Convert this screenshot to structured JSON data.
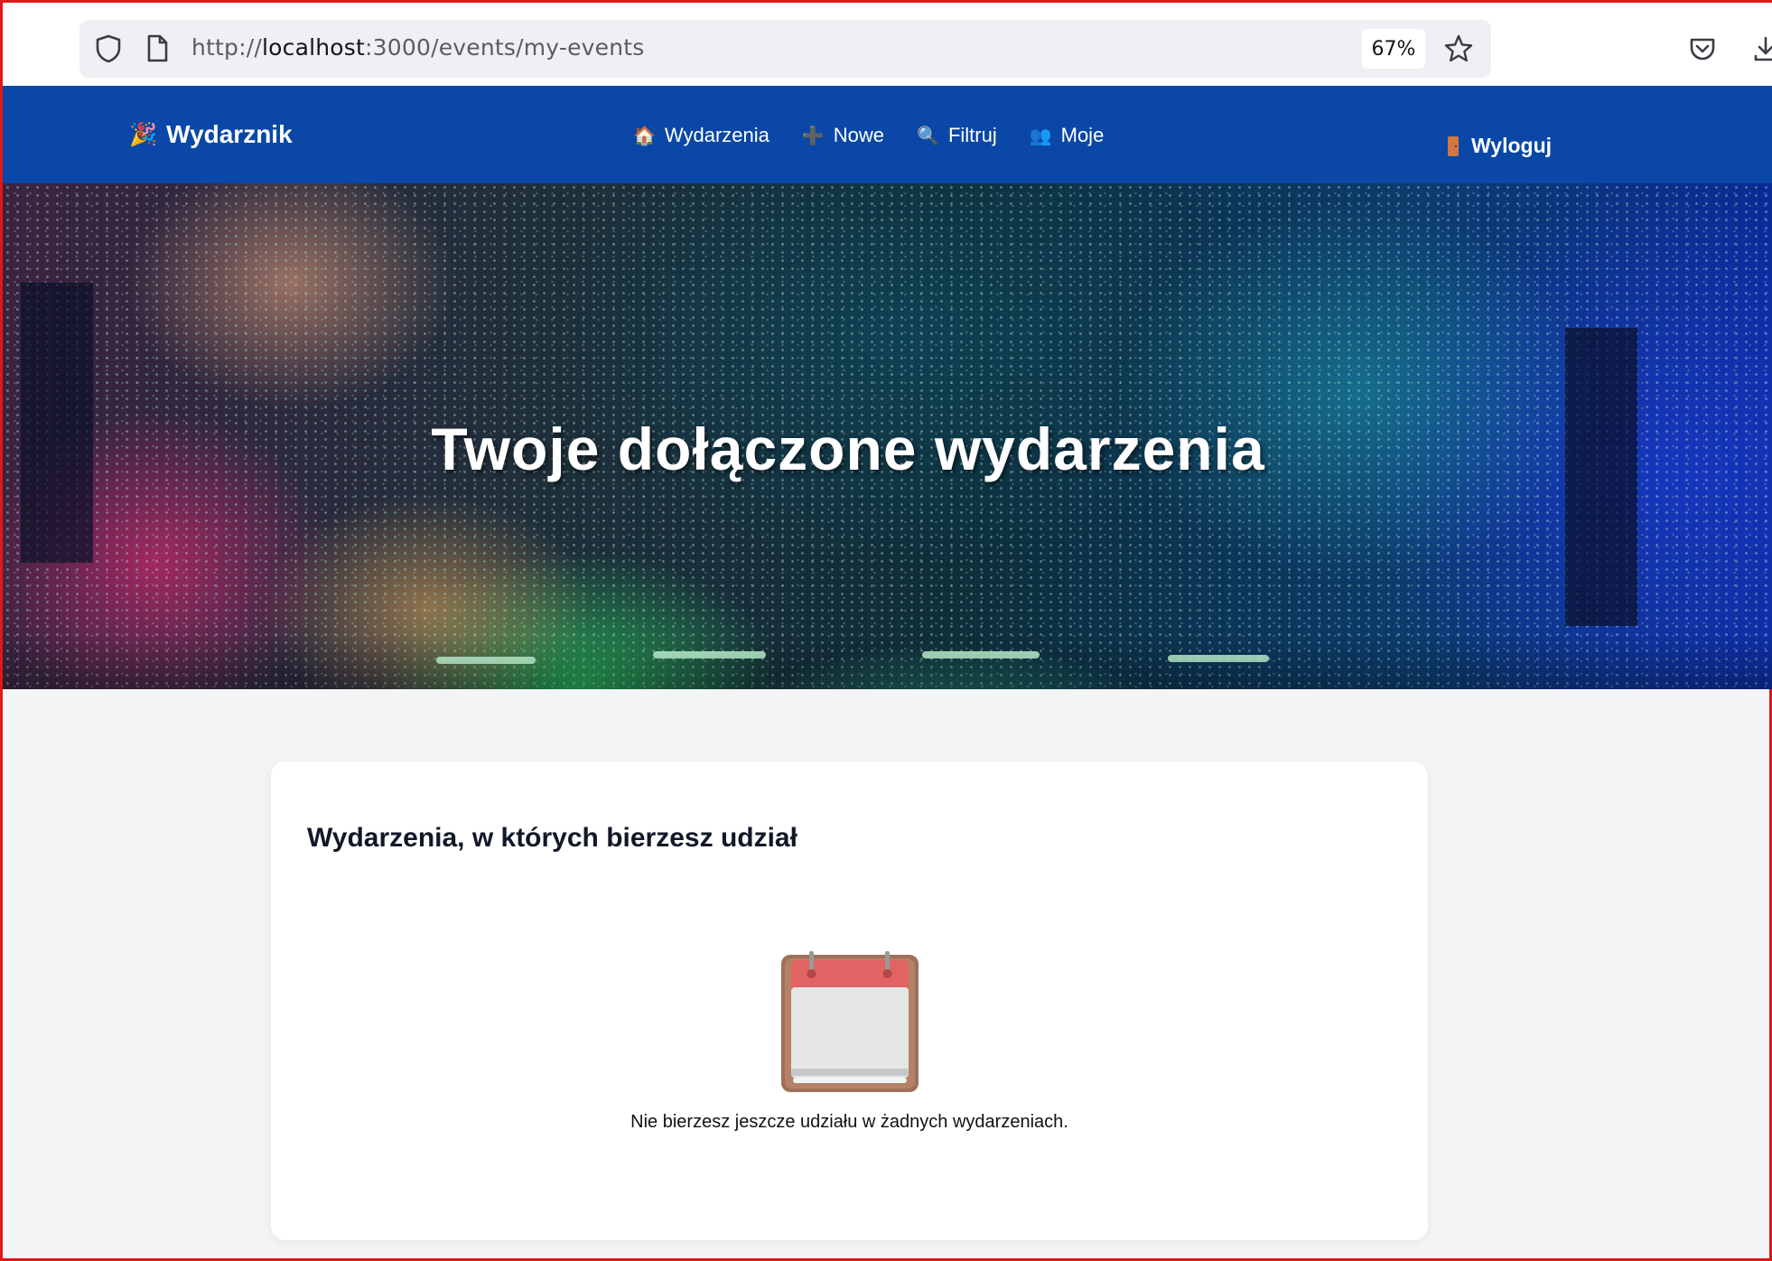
{
  "browser": {
    "url_scheme": "http://",
    "url_host": "localhost",
    "url_rest": ":3000/events/my-events",
    "zoom": "67%",
    "icons": [
      "shield-icon",
      "page-icon",
      "star-icon",
      "pocket-icon",
      "download-icon"
    ]
  },
  "navbar": {
    "brand_icon": "🎉",
    "brand_label": "Wydarznik",
    "links": [
      {
        "icon": "🏠",
        "label": "Wydarzenia"
      },
      {
        "icon": "➕",
        "label": "Nowe"
      },
      {
        "icon": "🔍",
        "label": "Filtruj"
      },
      {
        "icon": "👥",
        "label": "Moje"
      }
    ],
    "logout_label": "Wyloguj",
    "background_color": "#0a47a6"
  },
  "hero": {
    "title": "Twoje dołączone wydarzenia"
  },
  "card": {
    "title": "Wydarzenia, w których bierzesz udział",
    "empty_icon": "calendar-icon",
    "empty_message": "Nie bierzesz jeszcze udziału w żadnych wydarzeniach."
  }
}
